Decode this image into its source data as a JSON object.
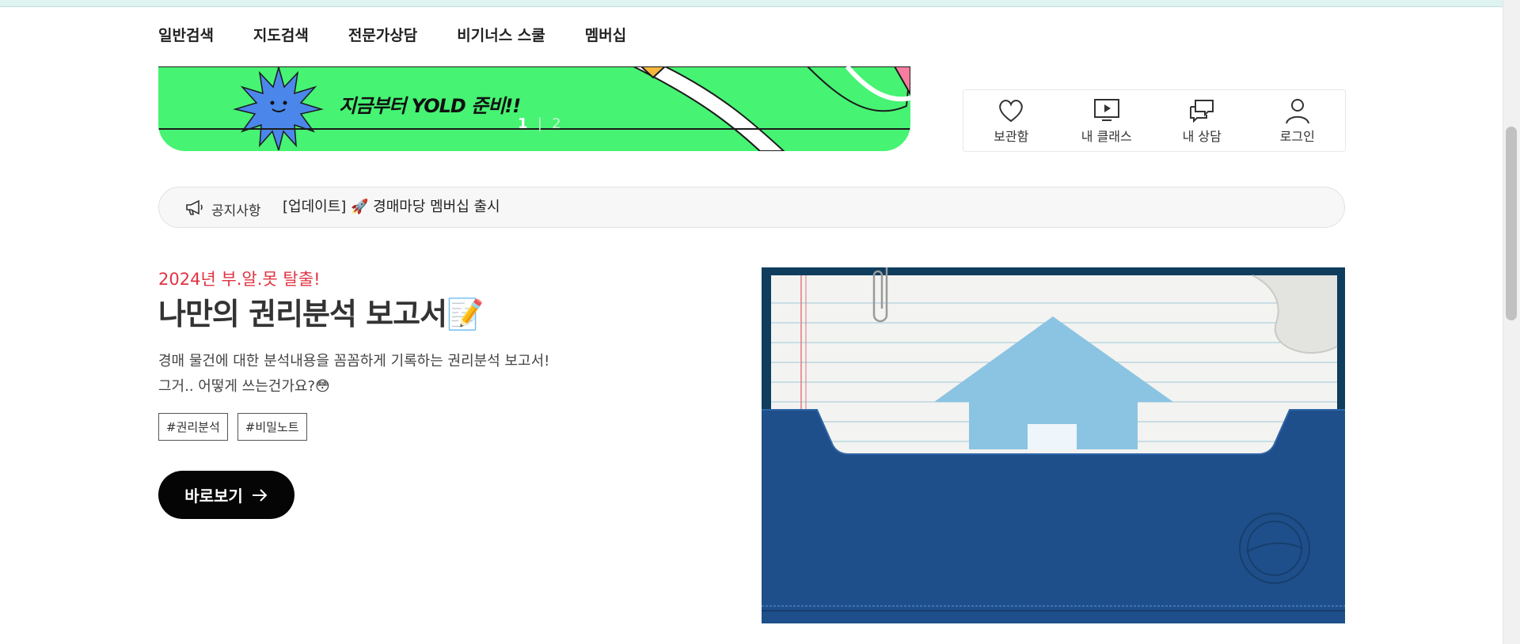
{
  "nav": {
    "items": [
      {
        "label": "일반검색"
      },
      {
        "label": "지도검색"
      },
      {
        "label": "전문가상담"
      },
      {
        "label": "비기너스 스쿨"
      },
      {
        "label": "멤버십"
      }
    ]
  },
  "banner": {
    "headline": "지금부터 YOLD 준비!!",
    "pager_current": "1",
    "pager_sep": "|",
    "pager_total": "2",
    "bg_color": "#46f373"
  },
  "quick_menu": {
    "items": [
      {
        "label": "보관함",
        "icon": "heart-icon"
      },
      {
        "label": "내 클래스",
        "icon": "play-screen-icon"
      },
      {
        "label": "내 상담",
        "icon": "chat-bubbles-icon"
      },
      {
        "label": "로그인",
        "icon": "user-icon"
      }
    ]
  },
  "notice": {
    "label": "공지사항",
    "text": "[업데이트] 🚀 경매마당 멤버십 출시"
  },
  "promo": {
    "subtitle": "2024년 부.알.못 탈출!",
    "title": "나만의 권리분석 보고서📝",
    "description_line1": "경매 물건에 대한 분석내용을 꼼꼼하게 기록하는 권리분석 보고서!",
    "description_line2": "그거.. 어떻게 쓰는건가요?😳",
    "tags": [
      "#권리분석",
      "#비밀노트"
    ],
    "cta_label": "바로보기",
    "accent_color": "#e03342"
  }
}
